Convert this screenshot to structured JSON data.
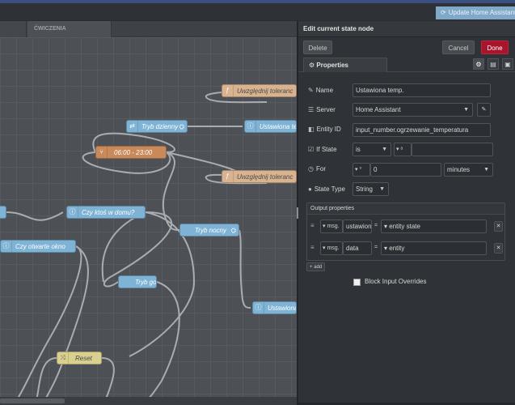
{
  "header": {
    "update_label": "Update Home Assistant f"
  },
  "workspace": {
    "tab_label": "ĆWICZENIA",
    "nodes": {
      "uwzgl1": "Uwzględnij toleranc",
      "tryb_dzienny": "Tryb dzienny",
      "ustawiona_top": "Ustawiona te",
      "time_range": "06:00 - 23:00",
      "uwzgl2": "Uwzględnij toleranc",
      "czy_ktos": "Czy ktoś w domu?",
      "tryb_nocny": "Tryb nocny",
      "czy_otwarte": "Czy otwarte okno",
      "tryb_goscia": "Tryb gościa",
      "ustawiona_bottom": "Ustawiona",
      "reset": "Reset"
    }
  },
  "panel": {
    "title": "Edit current state node",
    "delete_label": "Delete",
    "cancel_label": "Cancel",
    "done_label": "Done",
    "properties_tab": "Properties",
    "name_label": "Name",
    "name_value": "Ustawiona temp.",
    "server_label": "Server",
    "server_value": "Home Assistant",
    "entity_label": "Entity ID",
    "entity_value": "input_number.ogrzewanie_temperatura",
    "ifstate_label": "If State",
    "ifstate_op": "is",
    "for_label": "For",
    "for_value": "0",
    "for_unit": "minutes",
    "statetype_label": "State Type",
    "statetype_value": "String",
    "output_header": "Output properties",
    "outputs": [
      {
        "type": "msg.",
        "property": "ustawiona",
        "eq": "=",
        "value": "entity state"
      },
      {
        "type": "msg.",
        "property": "data",
        "eq": "=",
        "value": "entity"
      }
    ],
    "add_label": "add",
    "block_label": "Block Input Overrides"
  }
}
